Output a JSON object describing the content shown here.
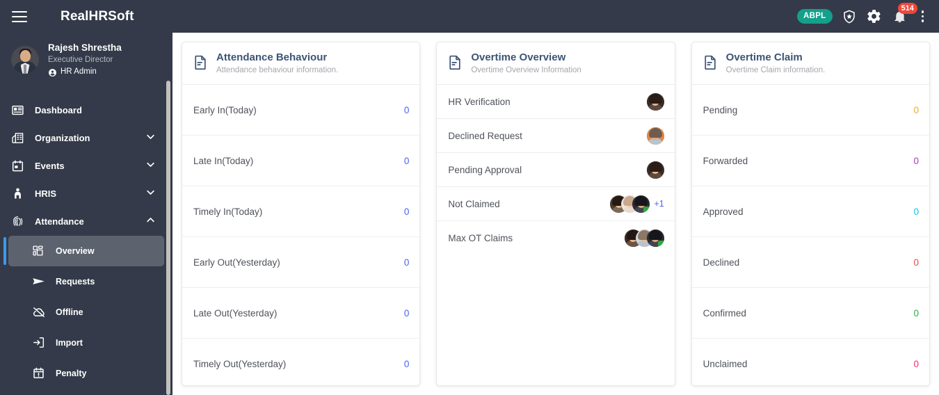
{
  "topbar": {
    "menu_icon": "hamburger-icon",
    "brand": "RealHRSoft",
    "org_badge": "ABPL",
    "shield_icon": "shield-star-icon",
    "settings_icon": "gear-icon",
    "notifications_icon": "bell-icon",
    "notifications_count": "514",
    "more_icon": "vertical-dots-icon",
    "badge_color": "#f0463c",
    "org_badge_color": "#14a08a"
  },
  "sidebar": {
    "profile": {
      "name": "Rajesh Shrestha",
      "designation": "Executive Director",
      "role": "HR Admin",
      "role_icon": "user-circle-icon",
      "avatar_icon": "avatar"
    },
    "items": [
      {
        "label": "Dashboard",
        "icon": "dashboard-icon",
        "expandable": false
      },
      {
        "label": "Organization",
        "icon": "organization-icon",
        "expandable": true,
        "chevron": "chevron-down-icon"
      },
      {
        "label": "Events",
        "icon": "calendar-icon",
        "expandable": true,
        "chevron": "chevron-down-icon"
      },
      {
        "label": "HRIS",
        "icon": "person-icon",
        "expandable": true,
        "chevron": "chevron-down-icon"
      },
      {
        "label": "Attendance",
        "icon": "fingerprint-icon",
        "expandable": true,
        "chevron": "chevron-up-icon"
      }
    ],
    "subitems": [
      {
        "label": "Overview",
        "icon": "grid-icon",
        "active": true
      },
      {
        "label": "Requests",
        "icon": "paper-plane-icon",
        "active": false
      },
      {
        "label": "Offline",
        "icon": "cloud-slash-icon",
        "active": false
      },
      {
        "label": "Import",
        "icon": "import-arrow-icon",
        "active": false
      },
      {
        "label": "Penalty",
        "icon": "calendar-alert-icon",
        "active": false
      }
    ],
    "active_accent": "#3d9ae8"
  },
  "cards": [
    {
      "title": "Attendance Behaviour",
      "subtitle": "Attendance behaviour information.",
      "icon": "document-icon",
      "rows": [
        {
          "label": "Early In(Today)",
          "value": "0",
          "color": "#4a63e7"
        },
        {
          "label": "Late In(Today)",
          "value": "0",
          "color": "#4a63e7"
        },
        {
          "label": "Timely In(Today)",
          "value": "0",
          "color": "#4a63e7"
        },
        {
          "label": "Early Out(Yesterday)",
          "value": "0",
          "color": "#4a63e7"
        },
        {
          "label": "Late Out(Yesterday)",
          "value": "0",
          "color": "#4a63e7"
        },
        {
          "label": "Timely Out(Yesterday)",
          "value": "0",
          "color": "#4a63e7"
        }
      ]
    },
    {
      "title": "Overtime Overview",
      "subtitle": "Overtime Overview Information",
      "icon": "document-icon",
      "rows": [
        {
          "label": "HR Verification",
          "avatars": 1,
          "extra": ""
        },
        {
          "label": "Declined Request",
          "avatars": 1,
          "extra": ""
        },
        {
          "label": "Pending Approval",
          "avatars": 1,
          "extra": ""
        },
        {
          "label": "Not Claimed",
          "avatars": 3,
          "extra": "+1"
        },
        {
          "label": "Max OT Claims",
          "avatars": 3,
          "extra": ""
        }
      ]
    },
    {
      "title": "Overtime Claim",
      "subtitle": "Overtime Claim information.",
      "icon": "document-icon",
      "rows": [
        {
          "label": "Pending",
          "value": "0",
          "color": "#f5a623"
        },
        {
          "label": "Forwarded",
          "value": "0",
          "color": "#b631c9"
        },
        {
          "label": "Approved",
          "value": "0",
          "color": "#19c3e0"
        },
        {
          "label": "Declined",
          "value": "0",
          "color": "#f0453c"
        },
        {
          "label": "Confirmed",
          "value": "0",
          "color": "#2aab3f"
        },
        {
          "label": "Unclaimed",
          "value": "0",
          "color": "#f02f63"
        }
      ]
    }
  ]
}
